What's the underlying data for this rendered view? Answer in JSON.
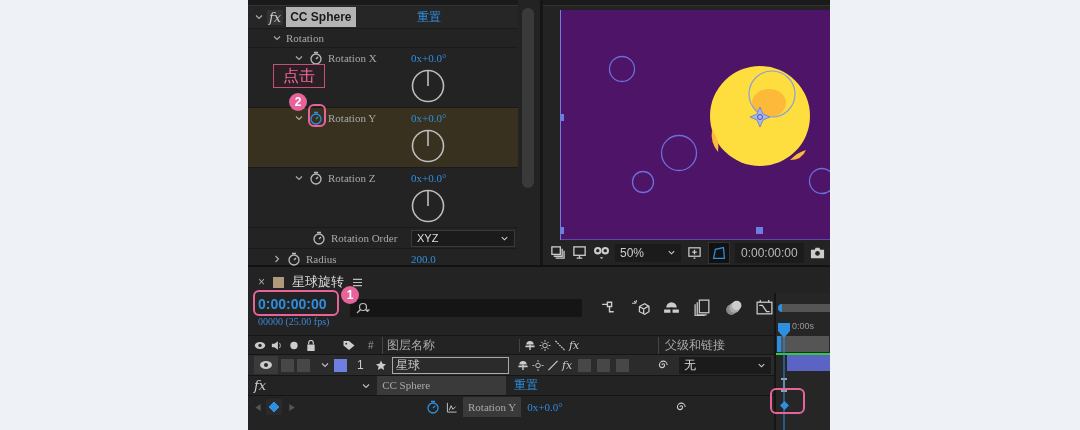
{
  "effect_controls": {
    "fx_icon": "fx",
    "effect_name": "CC Sphere",
    "expanded": true,
    "reset_link": "重置",
    "properties": [
      {
        "kind": "group",
        "label": "Rotation",
        "expanded": true
      },
      {
        "kind": "angle",
        "label": "Rotation X",
        "value": "0x+0.0°",
        "expanded": true,
        "selected": false,
        "stopwatch_on": false
      },
      {
        "kind": "angle",
        "label": "Rotation Y",
        "value": "0x+0.0°",
        "expanded": true,
        "selected": true,
        "stopwatch_on": true
      },
      {
        "kind": "angle",
        "label": "Rotation Z",
        "value": "0x+0.0°",
        "expanded": true,
        "selected": false,
        "stopwatch_on": false
      },
      {
        "kind": "dropdown",
        "label": "Rotation Order",
        "value": "XYZ",
        "stopwatch_on": false
      },
      {
        "kind": "number",
        "label": "Radius",
        "value": "200.0",
        "expanded": false,
        "stopwatch_on": false
      }
    ]
  },
  "viewer": {
    "zoom": "50%",
    "timecode": "0:00:00:00"
  },
  "timeline": {
    "close": "×",
    "comp_name": "星球旋转",
    "timecode": "0:00:00:00",
    "frame_info": "00000 (25.00 fps)",
    "ruler_label": "0:00s",
    "columns": {
      "number": "#",
      "layer_name": "图层名称",
      "effects": "fx",
      "parent": "父级和链接"
    },
    "layers": [
      {
        "number": "1",
        "name": "星球",
        "color": "#6f7fe0",
        "effects_switch": "fx",
        "parent": "无",
        "effect": {
          "fx_icon": "fx",
          "name": "CC Sphere",
          "reset": "重置"
        },
        "property": {
          "name": "Rotation Y",
          "value": "0x+0.0°",
          "stopwatch_on": true,
          "keyframe_at_time": true
        }
      }
    ]
  },
  "annotations": [
    {
      "kind": "callout",
      "text": "点击"
    },
    {
      "kind": "badge",
      "text": "2"
    },
    {
      "kind": "ring"
    },
    {
      "kind": "badge",
      "text": "1"
    },
    {
      "kind": "ring"
    },
    {
      "kind": "ring"
    }
  ]
}
